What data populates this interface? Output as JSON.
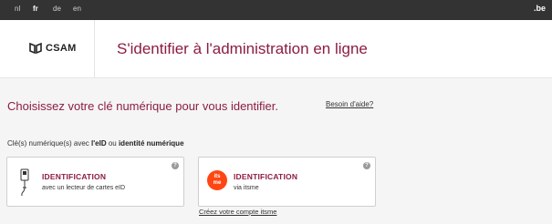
{
  "topbar": {
    "languages": [
      {
        "code": "nl",
        "active": false
      },
      {
        "code": "fr",
        "active": true
      },
      {
        "code": "de",
        "active": false
      },
      {
        "code": "en",
        "active": false
      }
    ],
    "logo": ".be"
  },
  "header": {
    "logo_text": "CSAM",
    "title": "S'identifier à l'administration en ligne"
  },
  "main": {
    "heading": "Choisissez votre clé numérique pour vous identifier.",
    "help_link": "Besoin d'aide?",
    "subtitle_prefix": "Clé(s) numérique(s) avec ",
    "subtitle_eid": "l'eID",
    "subtitle_mid": " ou ",
    "subtitle_digital": "identité numérique"
  },
  "cards": {
    "eid": {
      "title": "IDENTIFICATION",
      "subtitle": "avec un lecteur de cartes eID",
      "help": "?"
    },
    "itsme": {
      "title": "IDENTIFICATION",
      "subtitle": "via itsme",
      "help": "?",
      "icon_text_1": "its",
      "icon_text_2": "me"
    }
  },
  "create_itsme_link": "Créez votre compte itsme",
  "colors": {
    "accent": "#8c1d40",
    "topbar": "#333333",
    "itsme": "#ff4612"
  }
}
